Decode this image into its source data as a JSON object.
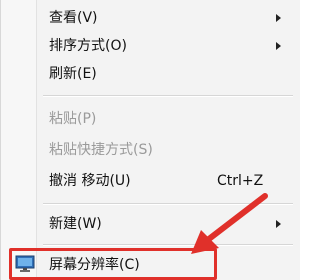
{
  "menu": {
    "items": [
      {
        "label": "查看(V)"
      },
      {
        "label": "排序方式(O)"
      },
      {
        "label": "刷新(E)"
      },
      {
        "label": "粘贴(P)"
      },
      {
        "label": "粘贴快捷方式(S)"
      },
      {
        "label": "撤消 移动(U)",
        "shortcut": "Ctrl+Z"
      },
      {
        "label": "新建(W)"
      },
      {
        "label": "屏幕分辨率(C)"
      }
    ]
  },
  "colors": {
    "menu_background": "#f3f3f3",
    "disabled_text": "#9a9a9a",
    "highlight": "#e0302a"
  },
  "icons": {
    "submenu": "chevron-right-icon",
    "resolution": "monitor-icon",
    "annotation": "red-arrow-icon"
  }
}
